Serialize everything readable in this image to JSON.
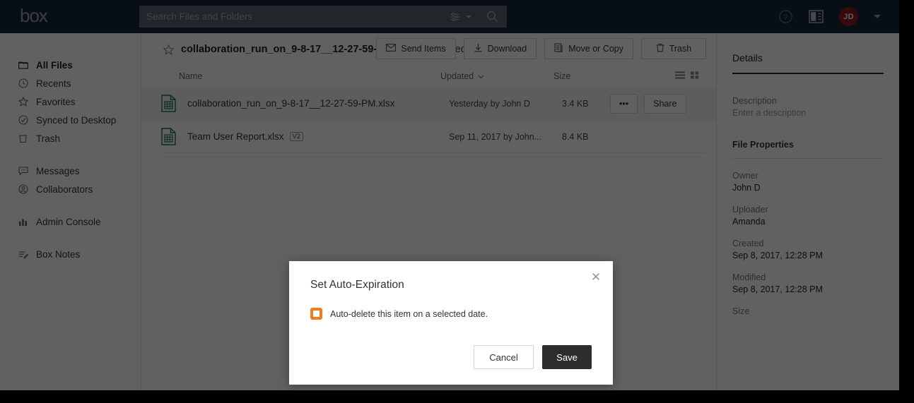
{
  "header": {
    "logo_text": "box",
    "search": {
      "placeholder": "Search Files and Folders",
      "value": "",
      "filter_icon": "filter-sliders-icon",
      "search_icon": "search-icon"
    },
    "help_icon": "help-circle-icon",
    "panel_icon": "side-panel-icon",
    "avatar_initials": "JD",
    "background_color": "#15263b"
  },
  "sidebar": {
    "items": [
      {
        "label": "All Files",
        "icon": "folder-icon",
        "active": true
      },
      {
        "label": "Recents",
        "icon": "clock-icon",
        "active": false
      },
      {
        "label": "Favorites",
        "icon": "star-icon",
        "active": false
      },
      {
        "label": "Synced to Desktop",
        "icon": "check-circle-icon",
        "active": false
      },
      {
        "label": "Trash",
        "icon": "trash-icon",
        "active": false
      },
      {
        "label": "Messages",
        "icon": "message-bubble-icon",
        "active": false
      },
      {
        "label": "Collaborators",
        "icon": "person-circle-icon",
        "active": false
      },
      {
        "label": "Admin Console",
        "icon": "bar-chart-icon",
        "active": false
      },
      {
        "label": "Box Notes",
        "icon": "notes-pencil-icon",
        "active": false
      }
    ]
  },
  "selection_bar": {
    "star_icon": "star-outline-icon",
    "selected_file": "collaboration_run_on_9-8-17__12-27-59-PM.xlsx",
    "suffix": " is selected",
    "actions": [
      {
        "label": "Send Items",
        "icon": "envelope-icon"
      },
      {
        "label": "Download",
        "icon": "download-icon"
      },
      {
        "label": "Move or Copy",
        "icon": "copy-icon"
      },
      {
        "label": "Trash",
        "icon": "trash-icon"
      }
    ]
  },
  "table": {
    "headers": {
      "name": "Name",
      "updated": "Updated",
      "size": "Size",
      "sort_icon": "chevron-down-icon",
      "list_view_icon": "list-view-icon",
      "grid_view_icon": "grid-view-icon"
    },
    "rows": [
      {
        "icon": "excel-file-icon",
        "name": "collaboration_run_on_9-8-17__12-27-59-PM.xlsx",
        "version_badge": "",
        "updated": "Yesterday by John D",
        "size": "3.4 KB",
        "selected": true,
        "more_label": "•••",
        "share_label": "Share"
      },
      {
        "icon": "excel-file-icon",
        "name": "Team User Report.xlsx",
        "version_badge": "V2",
        "updated": "Sep 11, 2017 by John...",
        "size": "8.4 KB",
        "selected": false,
        "more_label": "",
        "share_label": ""
      }
    ]
  },
  "details": {
    "title": "Details",
    "description_label": "Description",
    "description_placeholder": "Enter a description",
    "file_properties_label": "File Properties",
    "properties": [
      {
        "label": "Owner",
        "value": "John D"
      },
      {
        "label": "Uploader",
        "value": "Amanda"
      },
      {
        "label": "Created",
        "value": "Sep 8, 2017, 12:28 PM"
      },
      {
        "label": "Modified",
        "value": "Sep 8, 2017, 12:28 PM"
      },
      {
        "label": "Size",
        "value": ""
      }
    ]
  },
  "modal": {
    "title": "Set Auto-Expiration",
    "close_icon": "close-x-icon",
    "checkbox_label": "Auto-delete this item on a selected date.",
    "checkbox_checked": false,
    "checkbox_color": "#f07c1e",
    "cancel_label": "Cancel",
    "save_label": "Save"
  }
}
